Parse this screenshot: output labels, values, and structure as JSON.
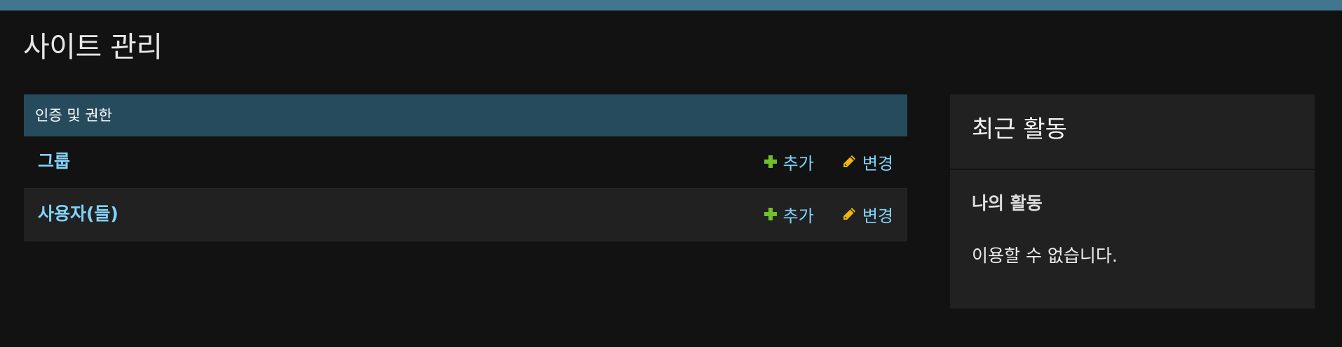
{
  "header": {
    "title": "사이트 관리"
  },
  "app_module": {
    "caption": "인증 및 권한",
    "models": [
      {
        "name": "그룹",
        "add_label": "추가",
        "change_label": "변경"
      },
      {
        "name": "사용자(들)",
        "add_label": "추가",
        "change_label": "변경"
      }
    ]
  },
  "recent_actions": {
    "title": "최근 활동",
    "subtitle": "나의 활동",
    "empty_text": "이용할 수 없습니다."
  },
  "colors": {
    "topbar": "#417690",
    "caption_bg": "#264b5d",
    "link": "#81d4fa",
    "add_icon": "#70bf2b",
    "change_icon": "#efb80b"
  },
  "icons": {
    "add": "plus-icon",
    "change": "pencil-icon"
  }
}
